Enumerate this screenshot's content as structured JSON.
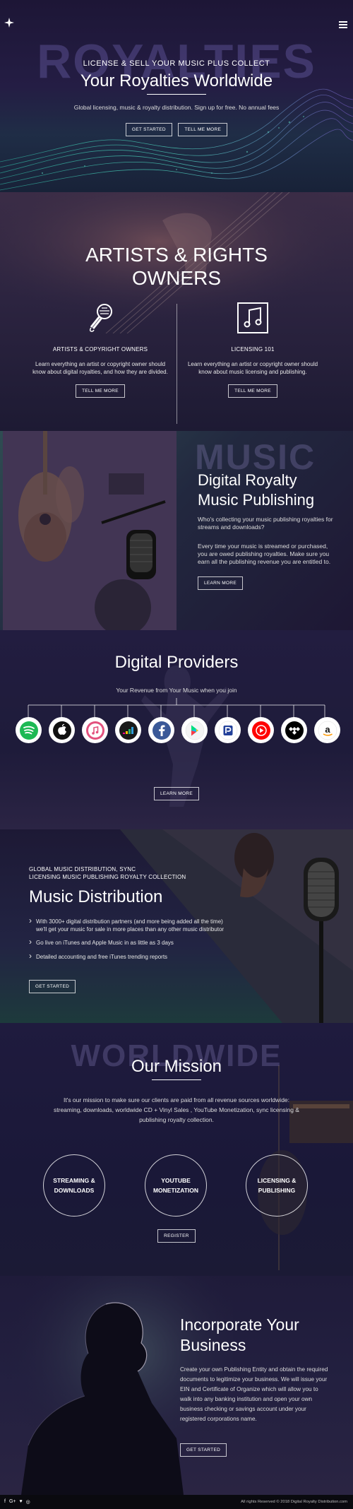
{
  "hero": {
    "bg_word": "ROYALTIES",
    "kicker": "LICENSE & SELL YOUR MUSIC PLUS COLLECT",
    "title": "Your Royalties Worldwide",
    "subtitle": "Global licensing, music & royalty distribution. Sign up for free. No annual fees",
    "btn_get_started": "GET STARTED",
    "btn_tell_me_more": "TELL ME MORE",
    "menu_icon": "hamburger-menu-icon",
    "logo_icon": "star-logo-icon"
  },
  "artists": {
    "title_line1": "ARTISTS & RIGHTS",
    "title_line2": "OWNERS",
    "col1": {
      "icon": "microphone-icon",
      "heading": "ARTISTS & COPYRIGHT OWNERS",
      "text": "Learn everything an artist or copyright owner should know about digital royalties, and how they are divided.",
      "button": "TELL ME MORE"
    },
    "col2": {
      "icon": "music-note-box-icon",
      "heading": "LICENSING 101",
      "text": "Learn everything an artist or copyright owner should know about music licensing and publishing.",
      "button": "TELL ME MORE"
    }
  },
  "publishing": {
    "bg_word": "MUSIC",
    "title_line1": "Digital Royalty",
    "title_line2": "Music Publishing",
    "p1": "Who's collecting your music publishing royalties for streams and downloads?",
    "p2": "Every time your music is streamed or purchased, you are owed publishing royalties. Make sure you earn all the publishing revenue you are entitled to.",
    "button": "LEARN MORE"
  },
  "providers": {
    "title": "Digital Providers",
    "subtitle": "Your Revenue from Your Music when you join",
    "icons": [
      "spotify-icon",
      "apple-icon",
      "itunes-icon",
      "deezer-icon",
      "facebook-icon",
      "google-play-icon",
      "pandora-icon",
      "youtube-music-icon",
      "tidal-icon",
      "amazon-icon"
    ],
    "button": "LEARN MORE"
  },
  "distribution": {
    "kicker_line1": "GLOBAL MUSIC DISTRIBUTION, SYNC",
    "kicker_line2": "LICENSING MUSIC PUBLISHING ROYALTY COLLECTION",
    "title": "Music Distribution",
    "items": [
      "With 3000+ digital distribution partners (and more being added all the time) we'll get your music for sale in more places than any other music distributor",
      "Go live on iTunes and Apple Music in as little as 3 days",
      "Detailed accounting and free iTunes trending reports"
    ],
    "button": "GET STARTED"
  },
  "mission": {
    "bg_word": "WORLDWIDE",
    "title": "Our Mission",
    "text": "It's our mission to make sure our clients are paid from all revenue sources worldwide: streaming, downloads, worldwide CD + Vinyl Sales , YouTube Monetization, sync licensing & publishing royalty collection.",
    "circle1_line1": "STREAMING &",
    "circle1_line2": "DOWNLOADS",
    "circle2_line1": "YOUTUBE",
    "circle2_line2": "MONETIZATION",
    "circle3_line1": "LICENSING &",
    "circle3_line2": "PUBLISHING",
    "button": "REGISTER"
  },
  "incorporate": {
    "title_line1": "Incorporate Your",
    "title_line2": "Business",
    "text": "Create your own Publishing Entity and obtain the required documents to legitimize your business. We will issue your EIN and Certificate of Organize which will allow you to walk into any banking institution and open your own business checking or savings account under your registered corporations name.",
    "button": "GET STARTED"
  },
  "footer": {
    "social": [
      "f",
      "G+",
      "♥",
      "◎"
    ],
    "social_icons": [
      "facebook-icon",
      "google-plus-icon",
      "twitter-icon",
      "instagram-icon"
    ],
    "copyright": "All rights Reserved © 2018 Digital Royalty Distribution.com"
  },
  "colors": {
    "bg_dark": "#16112a",
    "teal_accent": "#3fb7a4",
    "purple_bg": "#241d44"
  }
}
